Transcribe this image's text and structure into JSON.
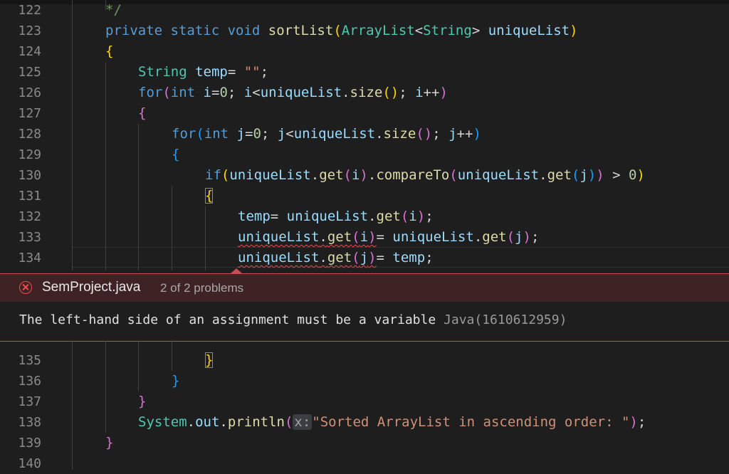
{
  "editor": {
    "top_lines": [
      {
        "num": "122",
        "tokens": [
          {
            "t": "*/",
            "c": "cmt"
          }
        ]
      },
      {
        "num": "123",
        "tokens": [
          {
            "t": "private ",
            "c": "kw"
          },
          {
            "t": "static ",
            "c": "kw"
          },
          {
            "t": "void ",
            "c": "kw"
          },
          {
            "t": "sortList",
            "c": "fn"
          },
          {
            "t": "(",
            "c": "p1"
          },
          {
            "t": "ArrayList",
            "c": "type"
          },
          {
            "t": "<",
            "c": "op"
          },
          {
            "t": "String",
            "c": "type"
          },
          {
            "t": "> ",
            "c": "op"
          },
          {
            "t": "uniqueList",
            "c": "var"
          },
          {
            "t": ")",
            "c": "p1"
          }
        ]
      },
      {
        "num": "124",
        "tokens": [
          {
            "t": "{",
            "c": "p1"
          }
        ]
      },
      {
        "num": "125",
        "tokens": [
          {
            "t": "String ",
            "c": "type"
          },
          {
            "t": "temp",
            "c": "var"
          },
          {
            "t": "= ",
            "c": "op"
          },
          {
            "t": "\"\"",
            "c": "str"
          },
          {
            "t": ";",
            "c": "op"
          }
        ]
      },
      {
        "num": "126",
        "tokens": [
          {
            "t": "for",
            "c": "kw"
          },
          {
            "t": "(",
            "c": "p2"
          },
          {
            "t": "int ",
            "c": "kw"
          },
          {
            "t": "i",
            "c": "var"
          },
          {
            "t": "=",
            "c": "op"
          },
          {
            "t": "0",
            "c": "num"
          },
          {
            "t": "; ",
            "c": "op"
          },
          {
            "t": "i",
            "c": "var"
          },
          {
            "t": "<",
            "c": "op"
          },
          {
            "t": "uniqueList",
            "c": "var"
          },
          {
            "t": ".",
            "c": "op"
          },
          {
            "t": "size",
            "c": "fn"
          },
          {
            "t": "()",
            "c": "p1"
          },
          {
            "t": "; ",
            "c": "op"
          },
          {
            "t": "i",
            "c": "var"
          },
          {
            "t": "++",
            "c": "op"
          },
          {
            "t": ")",
            "c": "p2"
          }
        ]
      },
      {
        "num": "127",
        "tokens": [
          {
            "t": "{",
            "c": "p2"
          }
        ]
      },
      {
        "num": "128",
        "tokens": [
          {
            "t": "for",
            "c": "kw"
          },
          {
            "t": "(",
            "c": "p3"
          },
          {
            "t": "int ",
            "c": "kw"
          },
          {
            "t": "j",
            "c": "var"
          },
          {
            "t": "=",
            "c": "op"
          },
          {
            "t": "0",
            "c": "num"
          },
          {
            "t": "; ",
            "c": "op"
          },
          {
            "t": "j",
            "c": "var"
          },
          {
            "t": "<",
            "c": "op"
          },
          {
            "t": "uniqueList",
            "c": "var"
          },
          {
            "t": ".",
            "c": "op"
          },
          {
            "t": "size",
            "c": "fn"
          },
          {
            "t": "()",
            "c": "p2"
          },
          {
            "t": "; ",
            "c": "op"
          },
          {
            "t": "j",
            "c": "var"
          },
          {
            "t": "++",
            "c": "op"
          },
          {
            "t": ")",
            "c": "p3"
          }
        ]
      },
      {
        "num": "129",
        "tokens": [
          {
            "t": "{",
            "c": "p3"
          }
        ]
      },
      {
        "num": "130",
        "tokens": [
          {
            "t": "if",
            "c": "kw"
          },
          {
            "t": "(",
            "c": "p1"
          },
          {
            "t": "uniqueList",
            "c": "var"
          },
          {
            "t": ".",
            "c": "op"
          },
          {
            "t": "get",
            "c": "fn"
          },
          {
            "t": "(",
            "c": "p2"
          },
          {
            "t": "i",
            "c": "var"
          },
          {
            "t": ")",
            "c": "p2"
          },
          {
            "t": ".",
            "c": "op"
          },
          {
            "t": "compareTo",
            "c": "fn"
          },
          {
            "t": "(",
            "c": "p2"
          },
          {
            "t": "uniqueList",
            "c": "var"
          },
          {
            "t": ".",
            "c": "op"
          },
          {
            "t": "get",
            "c": "fn"
          },
          {
            "t": "(",
            "c": "p3"
          },
          {
            "t": "j",
            "c": "var"
          },
          {
            "t": ")",
            "c": "p3"
          },
          {
            "t": ")",
            "c": "p2"
          },
          {
            "t": " > ",
            "c": "op"
          },
          {
            "t": "0",
            "c": "num"
          },
          {
            "t": ")",
            "c": "p1"
          }
        ]
      },
      {
        "num": "131",
        "tokens": [
          {
            "t": "{",
            "c": "p1 bracket-box"
          }
        ]
      },
      {
        "num": "132",
        "tokens": [
          {
            "t": "temp",
            "c": "var"
          },
          {
            "t": "= ",
            "c": "op"
          },
          {
            "t": "uniqueList",
            "c": "var"
          },
          {
            "t": ".",
            "c": "op"
          },
          {
            "t": "get",
            "c": "fn"
          },
          {
            "t": "(",
            "c": "p2"
          },
          {
            "t": "i",
            "c": "var"
          },
          {
            "t": ")",
            "c": "p2"
          },
          {
            "t": ";",
            "c": "op"
          }
        ]
      },
      {
        "num": "133",
        "tokens": [
          {
            "t": "uniqueList",
            "c": "var squig"
          },
          {
            "t": ".",
            "c": "op squig"
          },
          {
            "t": "get",
            "c": "fn squig"
          },
          {
            "t": "(",
            "c": "p2 squig"
          },
          {
            "t": "i",
            "c": "var squig"
          },
          {
            "t": ")",
            "c": "p2 squig"
          },
          {
            "t": "= ",
            "c": "op"
          },
          {
            "t": "uniqueList",
            "c": "var"
          },
          {
            "t": ".",
            "c": "op"
          },
          {
            "t": "get",
            "c": "fn"
          },
          {
            "t": "(",
            "c": "p2"
          },
          {
            "t": "j",
            "c": "var"
          },
          {
            "t": ")",
            "c": "p2"
          },
          {
            "t": ";",
            "c": "op"
          }
        ]
      },
      {
        "num": "134",
        "tokens": [
          {
            "t": "uniqueList",
            "c": "var squig"
          },
          {
            "t": ".",
            "c": "op squig"
          },
          {
            "t": "get",
            "c": "fn squig"
          },
          {
            "t": "(",
            "c": "p2 squig"
          },
          {
            "t": "j",
            "c": "var squig"
          },
          {
            "t": ")",
            "c": "p2 squig"
          },
          {
            "t": "= ",
            "c": "op"
          },
          {
            "t": "temp",
            "c": "var"
          },
          {
            "t": ";",
            "c": "op"
          }
        ]
      }
    ],
    "bottom_lines": [
      {
        "num": "135",
        "tokens": [
          {
            "t": "}",
            "c": "p1 bracket-box"
          }
        ]
      },
      {
        "num": "136",
        "tokens": [
          {
            "t": "}",
            "c": "p3"
          }
        ]
      },
      {
        "num": "137",
        "tokens": [
          {
            "t": "}",
            "c": "p2"
          }
        ]
      },
      {
        "num": "138",
        "tokens": [
          {
            "t": "System",
            "c": "type"
          },
          {
            "t": ".",
            "c": "op"
          },
          {
            "t": "out",
            "c": "var"
          },
          {
            "t": ".",
            "c": "op"
          },
          {
            "t": "println",
            "c": "fn"
          },
          {
            "t": "(",
            "c": "p2"
          },
          {
            "t": "x:",
            "c": "hint"
          },
          {
            "t": "\"Sorted ArrayList in ascending order: \"",
            "c": "str"
          },
          {
            "t": ")",
            "c": "p2"
          },
          {
            "t": ";",
            "c": "op"
          }
        ]
      },
      {
        "num": "139",
        "tokens": [
          {
            "t": "}",
            "c": "p2"
          }
        ]
      },
      {
        "num": "140",
        "tokens": []
      }
    ]
  },
  "problem_peek": {
    "file": "SemProject.java",
    "count": "2 of 2 problems",
    "message": "The left-hand side of an assignment must be a variable ",
    "source": "Java(1610612959)"
  }
}
